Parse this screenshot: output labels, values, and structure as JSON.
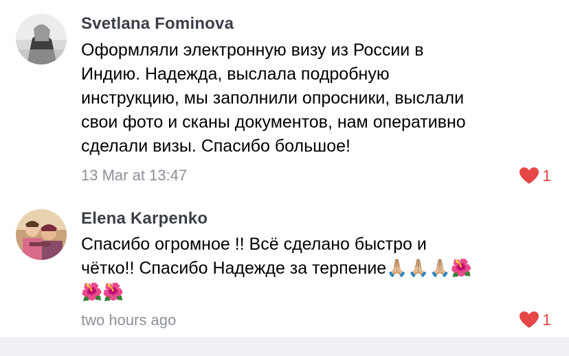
{
  "comments": [
    {
      "author": "Svetlana Fominova",
      "text": "Оформляли электронную визу из России в\nИндию. Надежда, выслала подробную\nинструкцию, мы заполнили опросники, выслали\nсвои фото и сканы документов, нам оперативно\nсделали визы. Спасибо большое!",
      "time": "13 Mar at 13:47",
      "likes": "1",
      "avatar_icon": "user-photo-avatar"
    },
    {
      "author": "Elena Karpenko",
      "text": "Спасибо огромное !! Всё сделано быстро  и\nчётко!! Спасибо Надежде за терпение🙏🏼🙏🏼🙏🏼🌺\n🌺🌺",
      "time": "two hours ago",
      "likes": "1",
      "avatar_icon": "user-photo-avatar"
    }
  ],
  "colors": {
    "author": "#3a3f47",
    "timestamp": "#8a9099",
    "like": "#e64646",
    "bottom_bar": "#eef0f3"
  }
}
